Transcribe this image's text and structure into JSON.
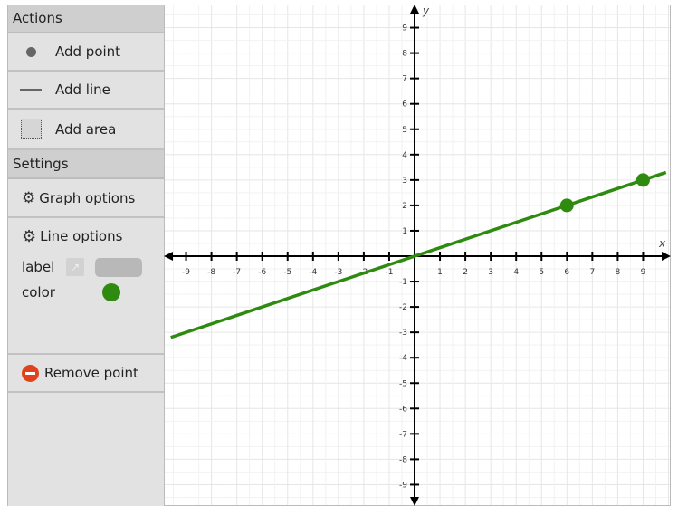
{
  "sidebar": {
    "actions_header": "Actions",
    "add_point": "Add point",
    "add_line": "Add line",
    "add_area": "Add area",
    "settings_header": "Settings",
    "graph_options": "Graph options",
    "line_options": "Line options",
    "label_label": "label",
    "color_label": "color",
    "line_color": "#2e8b10",
    "remove_point": "Remove point"
  },
  "graph": {
    "x_axis_label": "x",
    "y_axis_label": "y",
    "xlim": [
      -9.9,
      9.9
    ],
    "ylim": [
      -9.9,
      9.9
    ],
    "ticks": [
      -9,
      -8,
      -7,
      -6,
      -5,
      -4,
      -3,
      -2,
      -1,
      1,
      2,
      3,
      4,
      5,
      6,
      7,
      8,
      9
    ],
    "line": {
      "color": "#2e8b10",
      "points": [
        [
          6,
          2
        ],
        [
          9,
          3
        ]
      ]
    },
    "line_through_origin": true
  }
}
